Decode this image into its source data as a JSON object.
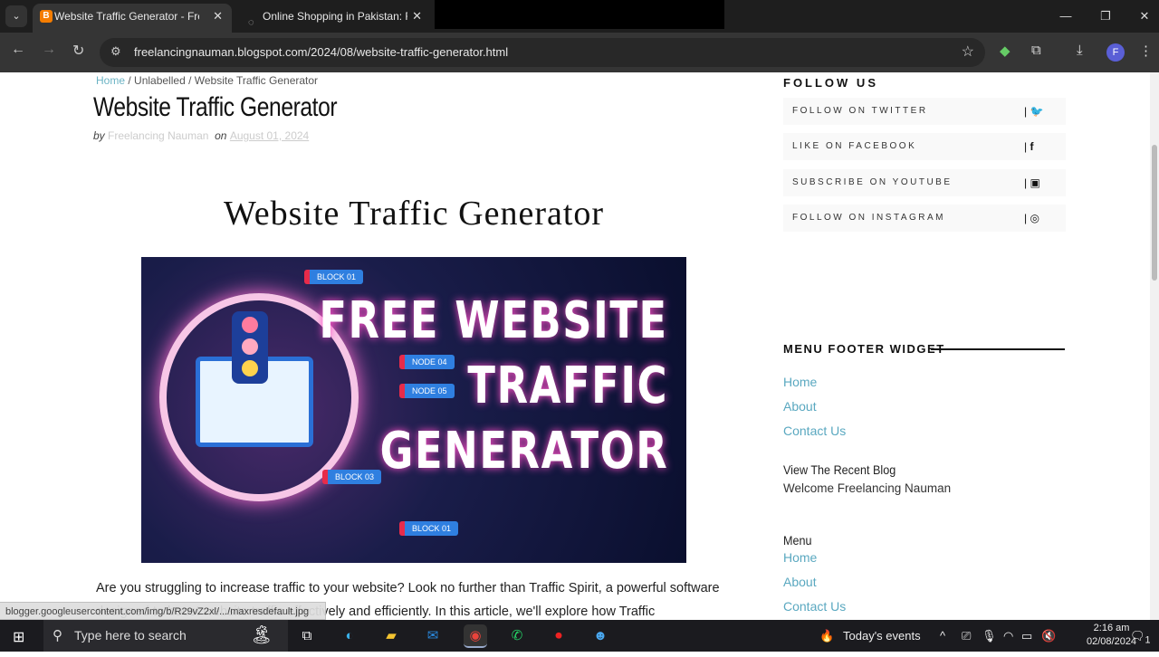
{
  "browser": {
    "tabs": [
      {
        "title": "Website Traffic Generator - Free",
        "active": true
      },
      {
        "title": "Online Shopping in Pakistan: Fa",
        "active": false
      }
    ],
    "url": "freelancingnauman.blogspot.com/2024/08/website-traffic-generator.html",
    "profile_initial": "F"
  },
  "post": {
    "breadcrumb": [
      "Home",
      "Unlabelled",
      "Website Traffic Generator"
    ],
    "title": "Website Traffic Generator",
    "by_label": "by",
    "author": "Freelancing Nauman",
    "on_label": "on",
    "date": "August 01, 2024",
    "heading": "Website Traffic Generator",
    "hero": {
      "line1": "FREE WEBSITE",
      "line2": "TRAFFIC",
      "line3": "GENERATOR",
      "nodes": [
        "BLOCK 01",
        "NODE 04",
        "NODE 05",
        "BLOCK 03",
        "BLOCK 01"
      ]
    },
    "paragraph": "Are you struggling to increase traffic to your website? Look no further than Traffic Spirit, a powerful software designed to boost website traffic effectively and efficiently. In this article, we'll explore how Traffic"
  },
  "sidebar": {
    "follow_title": "FOLLOW US",
    "social": [
      {
        "label": "FOLLOW ON TWITTER",
        "icon": "twitter-icon"
      },
      {
        "label": "LIKE ON FACEBOOK",
        "icon": "facebook-icon"
      },
      {
        "label": "SUBSCRIBE ON YOUTUBE",
        "icon": "youtube-icon"
      },
      {
        "label": "FOLLOW ON INSTAGRAM",
        "icon": "instagram-icon"
      }
    ],
    "menu_footer_title": "MENU FOOTER WIDGET",
    "menu_footer_links": [
      "Home",
      "About",
      "Contact Us"
    ],
    "recent_title": "View The Recent Blog",
    "recent_text": "Welcome Freelancing Nauman",
    "menu_title": "Menu",
    "menu_links": [
      "Home",
      "About",
      "Contact Us"
    ]
  },
  "status_url": "blogger.googleusercontent.com/img/b/R29vZ2xl/.../maxresdefault.jpg",
  "taskbar": {
    "search_placeholder": "Type here to search",
    "events": "Today's events",
    "time": "2:16 am",
    "date": "02/08/2024",
    "notifications": "1"
  }
}
